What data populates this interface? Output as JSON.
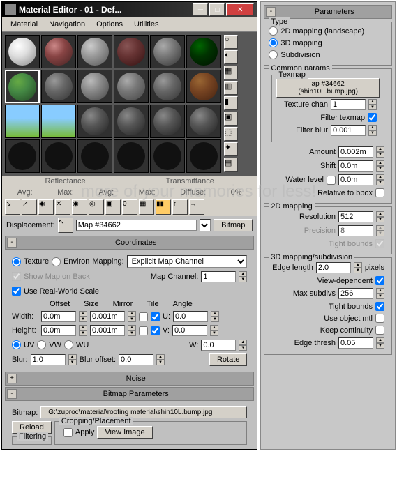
{
  "window": {
    "title": "Material Editor - 01 - Def..."
  },
  "menu": {
    "material": "Material",
    "navigation": "Navigation",
    "options": "Options",
    "utilities": "Utilities"
  },
  "stats": {
    "reflectance": "Reflectance",
    "transmittance": "Transmittance",
    "avg": "Avg:",
    "max": "Max:",
    "diffuse": "Diffuse:",
    "diffuse_val": "0%"
  },
  "displacement": {
    "label": "Displacement:",
    "map_name": "Map #34662",
    "type": "Bitmap"
  },
  "rollups": {
    "coordinates": "Coordinates",
    "noise": "Noise",
    "bitmap_params": "Bitmap Parameters"
  },
  "coords": {
    "texture": "Texture",
    "environ": "Environ",
    "mapping_label": "Mapping:",
    "mapping_value": "Explicit Map Channel",
    "show_map": "Show Map on Back",
    "map_channel_label": "Map Channel:",
    "map_channel": "1",
    "use_real_world": "Use Real-World Scale",
    "offset": "Offset",
    "size": "Size",
    "mirror": "Mirror",
    "tile": "Tile",
    "angle": "Angle",
    "width_label": "Width:",
    "height_label": "Height:",
    "width_offset": "0.0m",
    "width_size": "0.001m",
    "height_offset": "0.0m",
    "height_size": "0.001m",
    "u_label": "U:",
    "v_label": "V:",
    "w_label": "W:",
    "u": "0.0",
    "v": "0.0",
    "w": "0.0",
    "uv": "UV",
    "vw": "VW",
    "wu": "WU",
    "blur_label": "Blur:",
    "blur": "1.0",
    "blur_offset_label": "Blur offset:",
    "blur_offset": "0.0",
    "rotate": "Rotate"
  },
  "bitmap": {
    "label": "Bitmap:",
    "path": "G:\\zuproc\\material\\roofing material\\shin10L.bump.jpg",
    "reload": "Reload",
    "filtering": "Filtering",
    "cropping": "Cropping/Placement",
    "apply": "Apply",
    "view_image": "View Image"
  },
  "params": {
    "title": "Parameters",
    "type_label": "Type",
    "mapping_2d": "2D mapping (landscape)",
    "mapping_3d": "3D mapping",
    "subdivision": "Subdivision",
    "common_params": "Common params",
    "texmap": "Texmap",
    "texmap_btn": "ap #34662 (shin10L.bump.jpg)",
    "texture_chan_label": "Texture chan",
    "texture_chan": "1",
    "filter_texmap": "Filter texmap",
    "filter_blur_label": "Filter blur",
    "filter_blur": "0.001",
    "amount_label": "Amount",
    "amount": "0.002m",
    "shift_label": "Shift",
    "shift": "0.0m",
    "water_level_label": "Water level",
    "water_level": "0.0m",
    "relative_bbox": "Relative to bbox",
    "mapping_2d_section": "2D mapping",
    "resolution_label": "Resolution",
    "resolution": "512",
    "precision_label": "Precision",
    "precision": "8",
    "tight_bounds_2d": "Tight bounds",
    "mapping_3d_section": "3D mapping/subdivision",
    "edge_length_label": "Edge length",
    "edge_length": "2.0",
    "pixels": "pixels",
    "view_dependent": "View-dependent",
    "max_subdivs_label": "Max subdivs",
    "max_subdivs": "256",
    "tight_bounds_3d": "Tight bounds",
    "use_object_mtl": "Use object mtl",
    "keep_continuity": "Keep continuity",
    "edge_thresh_label": "Edge thresh",
    "edge_thresh": "0.05"
  },
  "watermark": "more of your memories for less!"
}
